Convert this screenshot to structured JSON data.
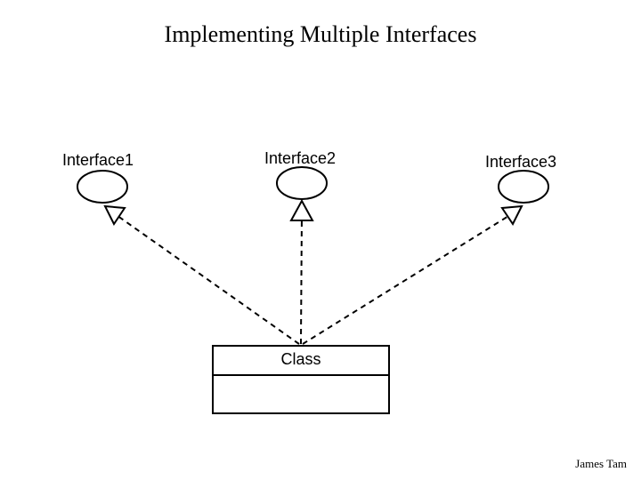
{
  "title": "Implementing Multiple Interfaces",
  "interfaces": {
    "iface1": "Interface1",
    "iface2": "Interface2",
    "iface3": "Interface3"
  },
  "class_label": "Class",
  "credit": "James Tam",
  "chart_data": {
    "type": "diagram",
    "description": "UML-style diagram: one Class implements three interfaces via dashed realization arrows with hollow triangular arrowheads pointing to lollipop/ellipse interface symbols.",
    "nodes": [
      {
        "id": "Interface1",
        "kind": "interface",
        "position": "top-left"
      },
      {
        "id": "Interface2",
        "kind": "interface",
        "position": "top-center"
      },
      {
        "id": "Interface3",
        "kind": "interface",
        "position": "top-right"
      },
      {
        "id": "Class",
        "kind": "class",
        "position": "bottom-center"
      }
    ],
    "edges": [
      {
        "from": "Class",
        "to": "Interface1",
        "style": "dashed-realization"
      },
      {
        "from": "Class",
        "to": "Interface2",
        "style": "dashed-realization"
      },
      {
        "from": "Class",
        "to": "Interface3",
        "style": "dashed-realization"
      }
    ]
  }
}
